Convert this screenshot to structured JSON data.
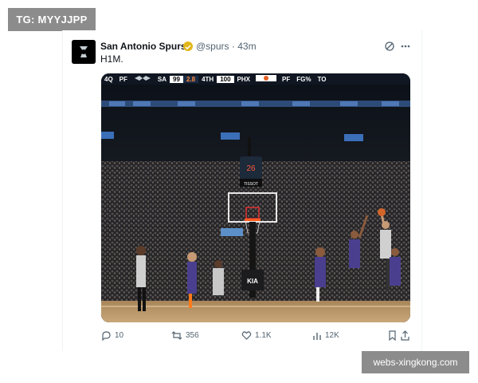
{
  "watermark_top_left": "TG: MYYJJPP",
  "watermark_bottom_right": "webs-xingkong.com",
  "tweet": {
    "author_name": "San Antonio Spurs",
    "handle": "@spurs",
    "separator": "·",
    "time": "43m",
    "text": "H1M.",
    "verified_color": "#e2b719"
  },
  "scoreboard": {
    "left_quarter": "4Q",
    "left_label": "PF",
    "home_team": "SA",
    "home_score": "99",
    "clock": "2.8",
    "quarter": "4TH",
    "away_score": "100",
    "away_team": "PHX",
    "right_pf": "PF",
    "right_fg": "FG%",
    "right_to": "TO"
  },
  "arena": {
    "shot_clock": "26",
    "sponsor": "TISSOT",
    "court_logo": "KIA"
  },
  "actions": {
    "replies": "10",
    "reposts": "356",
    "likes": "1.1K",
    "views": "12K"
  }
}
